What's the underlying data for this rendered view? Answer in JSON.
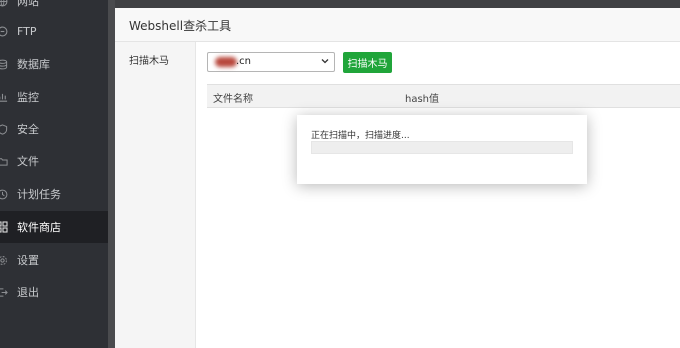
{
  "sidebar": {
    "items": [
      {
        "label": "网站",
        "icon": "globe-icon"
      },
      {
        "label": "FTP",
        "icon": "ftp-icon"
      },
      {
        "label": "数据库",
        "icon": "database-icon"
      },
      {
        "label": "监控",
        "icon": "monitor-icon"
      },
      {
        "label": "安全",
        "icon": "shield-icon"
      },
      {
        "label": "文件",
        "icon": "folder-icon"
      },
      {
        "label": "计划任务",
        "icon": "clock-icon"
      },
      {
        "label": "软件商店",
        "icon": "apps-grid-icon",
        "active": true
      },
      {
        "label": "设置",
        "icon": "gear-icon"
      },
      {
        "label": "退出",
        "icon": "logout-icon"
      }
    ]
  },
  "dialog": {
    "title": "Webshell查杀工具",
    "left_tab": "扫描木马",
    "site_select": {
      "value_suffix": ".cn"
    },
    "scan_button": "扫描木马",
    "table": {
      "columns": [
        "文件名称",
        "hash值"
      ]
    }
  },
  "popup": {
    "text": "正在扫描中，扫描进度...",
    "progress": 0
  },
  "colors": {
    "accent": "#20a53a",
    "sidebar_bg": "#2e3035"
  }
}
